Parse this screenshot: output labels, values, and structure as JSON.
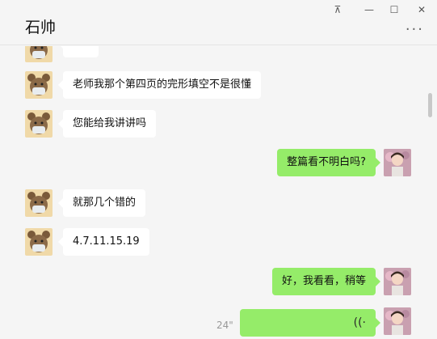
{
  "window": {
    "title": "石帅",
    "pin_glyph": "⊼",
    "minimize_glyph": "—",
    "maximize_glyph": "☐",
    "close_glyph": "✕",
    "more_glyph": "···"
  },
  "messages": [
    {
      "side": "left",
      "text": "老师我那个第四页的完形填空不是很懂"
    },
    {
      "side": "left",
      "text": "您能给我讲讲吗"
    },
    {
      "side": "right",
      "text": "整篇看不明白吗?"
    },
    {
      "side": "left",
      "text": "就那几个错的"
    },
    {
      "side": "left",
      "text": "4.7.11.15.19"
    },
    {
      "side": "right",
      "text": "好，我看看，稍等"
    },
    {
      "side": "right",
      "type": "voice",
      "duration": "24\""
    }
  ],
  "icons": {
    "voice": "voice-wave-icon",
    "wave_glyph": "((·"
  },
  "colors": {
    "accent": "#95ec69",
    "background": "#f5f5f5",
    "bubble_left": "#ffffff"
  }
}
